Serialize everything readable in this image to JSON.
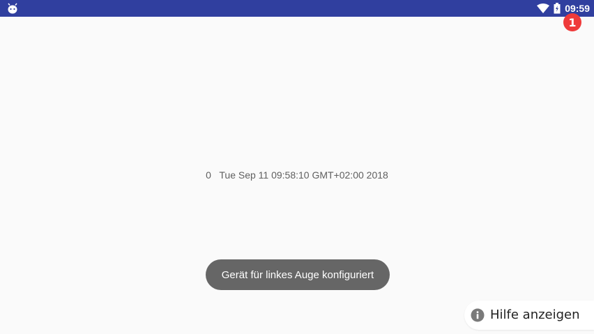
{
  "status_bar": {
    "color": "#303f9f",
    "left_icon": "android-debug-icon",
    "time": "09:59",
    "wifi_icon": "wifi-icon",
    "battery_icon": "battery-charging-icon"
  },
  "notification_badge": {
    "count": "1",
    "color": "#ef3a3a"
  },
  "main": {
    "counter": "0",
    "timestamp": "Tue Sep 11 09:58:10 GMT+02:00 2018"
  },
  "toast": {
    "text": "Gerät für linkes Auge konfiguriert",
    "color": "#666666"
  },
  "help": {
    "label": "Hilfe anzeigen",
    "icon": "info-icon"
  }
}
